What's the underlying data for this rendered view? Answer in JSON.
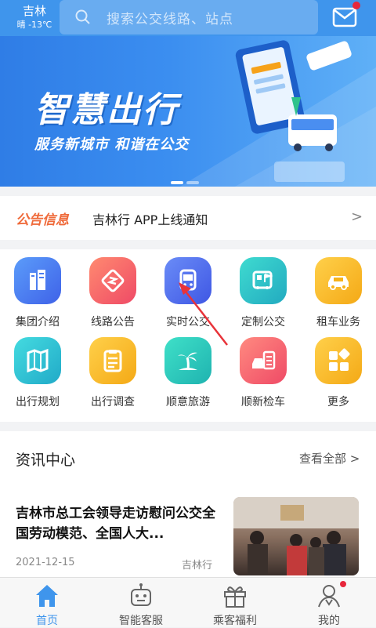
{
  "header": {
    "city": "吉林",
    "weather": "晴 -13℃",
    "search_placeholder": "搜索公交线路、站点",
    "accent": "#3f95ec"
  },
  "banner": {
    "title": "智慧出行",
    "subtitle": "服务新城市 和谐在公交",
    "page_index": 1,
    "page_count": 2
  },
  "notice": {
    "tag": "公告信息",
    "text": "吉林行 APP上线通知",
    "chevron": ">"
  },
  "services": [
    {
      "label": "集团介绍",
      "icon": "building-icon",
      "color": "#4a7cf0"
    },
    {
      "label": "线路公告",
      "icon": "route-icon",
      "color": "#f25b6a"
    },
    {
      "label": "实时公交",
      "icon": "bus-icon",
      "color": "#4a6df0"
    },
    {
      "label": "定制公交",
      "icon": "custom-bus-icon",
      "color": "#2dc3c8"
    },
    {
      "label": "租车业务",
      "icon": "car-icon",
      "color": "#f6b21a"
    },
    {
      "label": "出行规划",
      "icon": "map-icon",
      "color": "#2cc1c9"
    },
    {
      "label": "出行调查",
      "icon": "survey-icon",
      "color": "#f6b21a"
    },
    {
      "label": "顺意旅游",
      "icon": "palm-tree-icon",
      "color": "#2dc3b8"
    },
    {
      "label": "顺新检车",
      "icon": "car-inspection-icon",
      "color": "#f5616b"
    },
    {
      "label": "更多",
      "icon": "more-grid-icon",
      "color": "#f6b21a"
    }
  ],
  "news": {
    "header": "资讯中心",
    "view_all": "查看全部",
    "article": {
      "title": "吉林市总工会领导走访慰问公交全国劳动模范、全国人大...",
      "date": "2021-12-15",
      "source": "吉林行"
    }
  },
  "tabbar": [
    {
      "label": "首页",
      "icon": "home-icon",
      "active": true
    },
    {
      "label": "智能客服",
      "icon": "robot-icon",
      "active": false
    },
    {
      "label": "乘客福利",
      "icon": "gift-icon",
      "active": false
    },
    {
      "label": "我的",
      "icon": "profile-icon",
      "active": false
    }
  ]
}
